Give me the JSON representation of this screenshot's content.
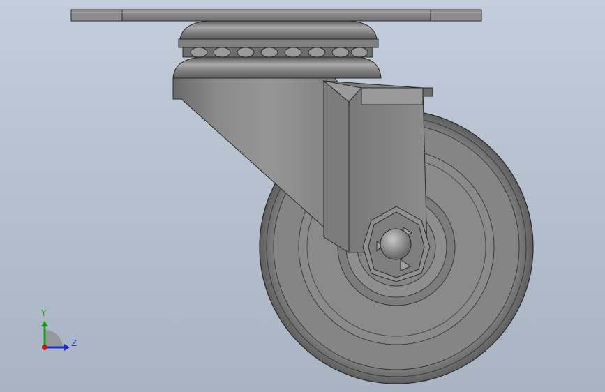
{
  "viewport": {
    "background_top": "#c3cddb",
    "background_bottom": "#a9b4c3"
  },
  "model": {
    "description_icon": "caster-wheel-model"
  },
  "triad": {
    "y_label": "Y",
    "z_label": "Z",
    "y_color": "#1f9a1f",
    "z_color": "#1e2fd0",
    "x_color": "#c41818"
  }
}
